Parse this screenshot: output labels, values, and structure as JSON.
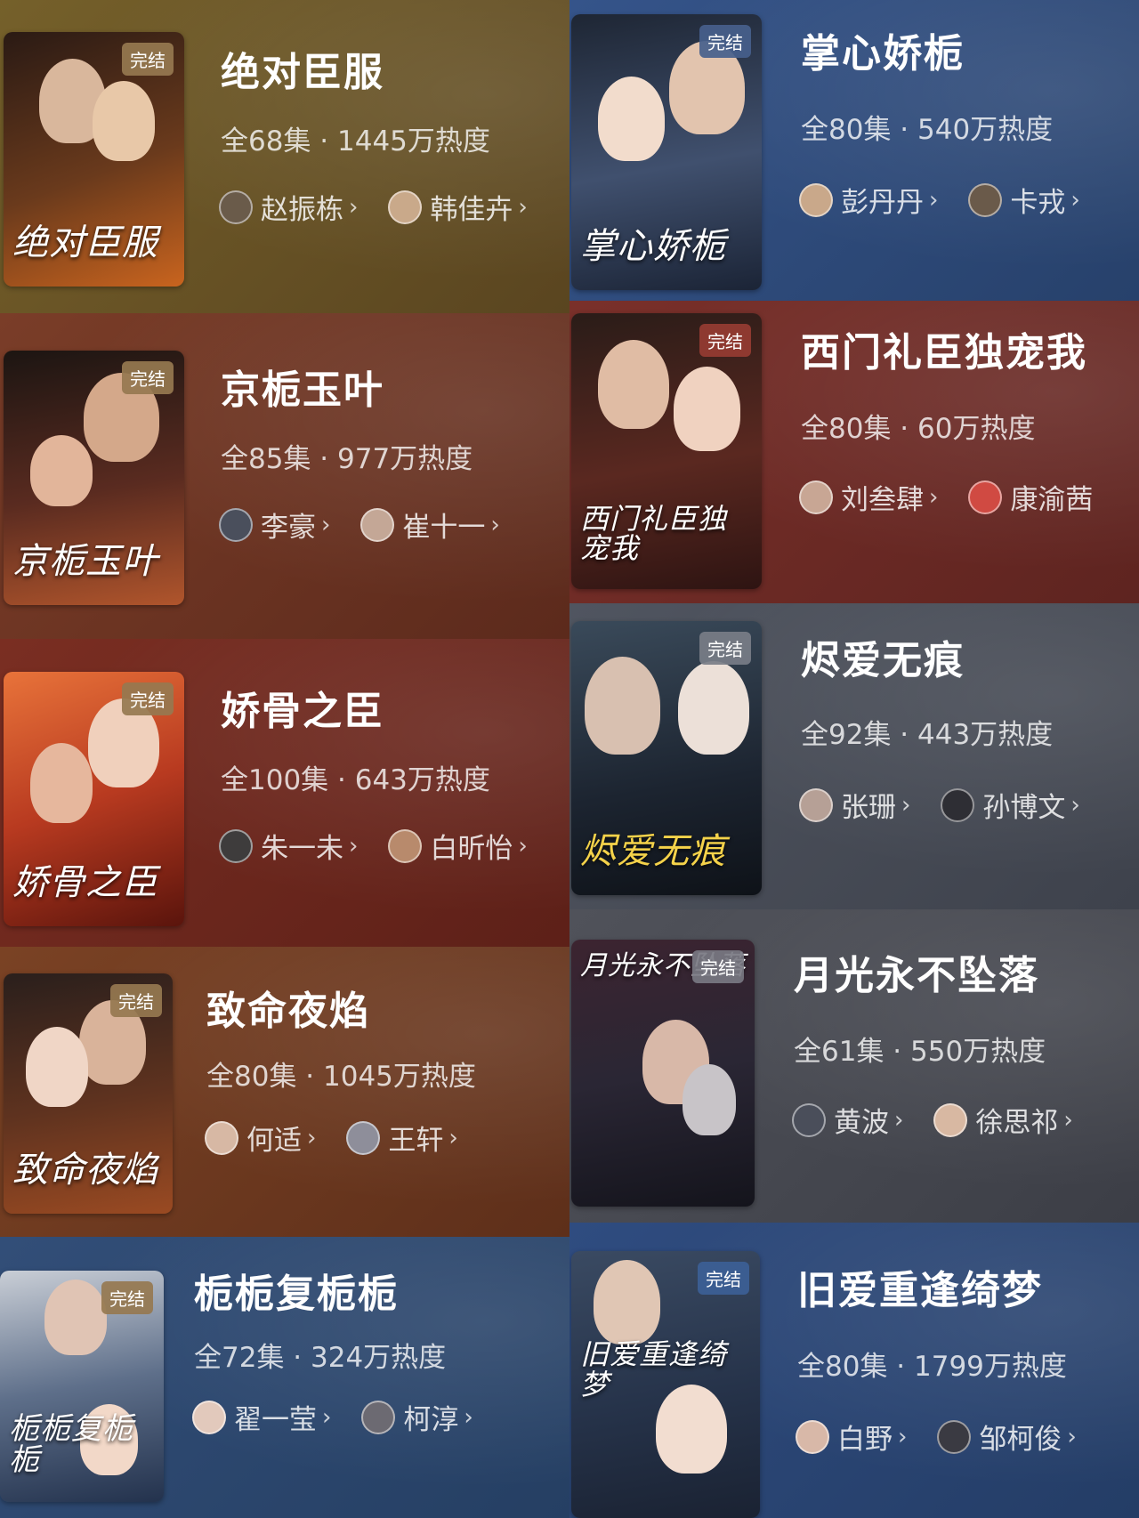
{
  "badge_label": "完结",
  "dramas": [
    {
      "title": "绝对臣服",
      "meta": "全68集 · 1445万热度",
      "poster_text": "绝对臣服",
      "cast": [
        "赵振栋",
        "韩佳卉"
      ]
    },
    {
      "title": "京栀玉叶",
      "meta": "全85集 · 977万热度",
      "poster_text": "京栀玉叶",
      "cast": [
        "李豪",
        "崔十一"
      ]
    },
    {
      "title": "娇骨之臣",
      "meta": "全100集 · 643万热度",
      "poster_text": "娇骨之臣",
      "cast": [
        "朱一未",
        "白昕怡"
      ]
    },
    {
      "title": "致命夜焰",
      "meta": "全80集 · 1045万热度",
      "poster_text": "致命夜焰",
      "cast": [
        "何适",
        "王轩"
      ]
    },
    {
      "title": "栀栀复栀栀",
      "meta": "全72集 · 324万热度",
      "poster_text": "栀栀复栀栀",
      "cast": [
        "翟一莹",
        "柯淳"
      ]
    },
    {
      "title": "掌心娇栀",
      "meta": "全80集 · 540万热度",
      "poster_text": "掌心娇栀",
      "cast": [
        "彭丹丹",
        "卡戎"
      ]
    },
    {
      "title": "西门礼臣独宠我",
      "meta": "全80集 · 60万热度",
      "poster_text": "西门礼臣独宠我",
      "cast": [
        "刘叁肆",
        "康渝茜"
      ]
    },
    {
      "title": "烬爱无痕",
      "meta": "全92集 · 443万热度",
      "poster_text": "烬爱无痕",
      "cast": [
        "张珊",
        "孙博文"
      ]
    },
    {
      "title": "月光永不坠落",
      "meta": "全61集 · 550万热度",
      "poster_text": "月光永不坠落",
      "cast": [
        "黄波",
        "徐思祁"
      ]
    },
    {
      "title": "旧爱重逢绮梦",
      "meta": "全80集 · 1799万热度",
      "poster_text": "旧爱重逢绮梦",
      "cast": [
        "白野",
        "邹柯俊"
      ]
    }
  ],
  "colors": {
    "card_1": "#6b5523",
    "card_2": "#6e3524",
    "card_3": "#6b2a20",
    "card_4": "#6b3a20",
    "card_5": "#2d4a72",
    "card_6": "#2f4c7a",
    "card_7": "#6b2b26",
    "card_8": "#4a4e58",
    "card_9": "#4b4d55",
    "card_10": "#2c4878"
  }
}
